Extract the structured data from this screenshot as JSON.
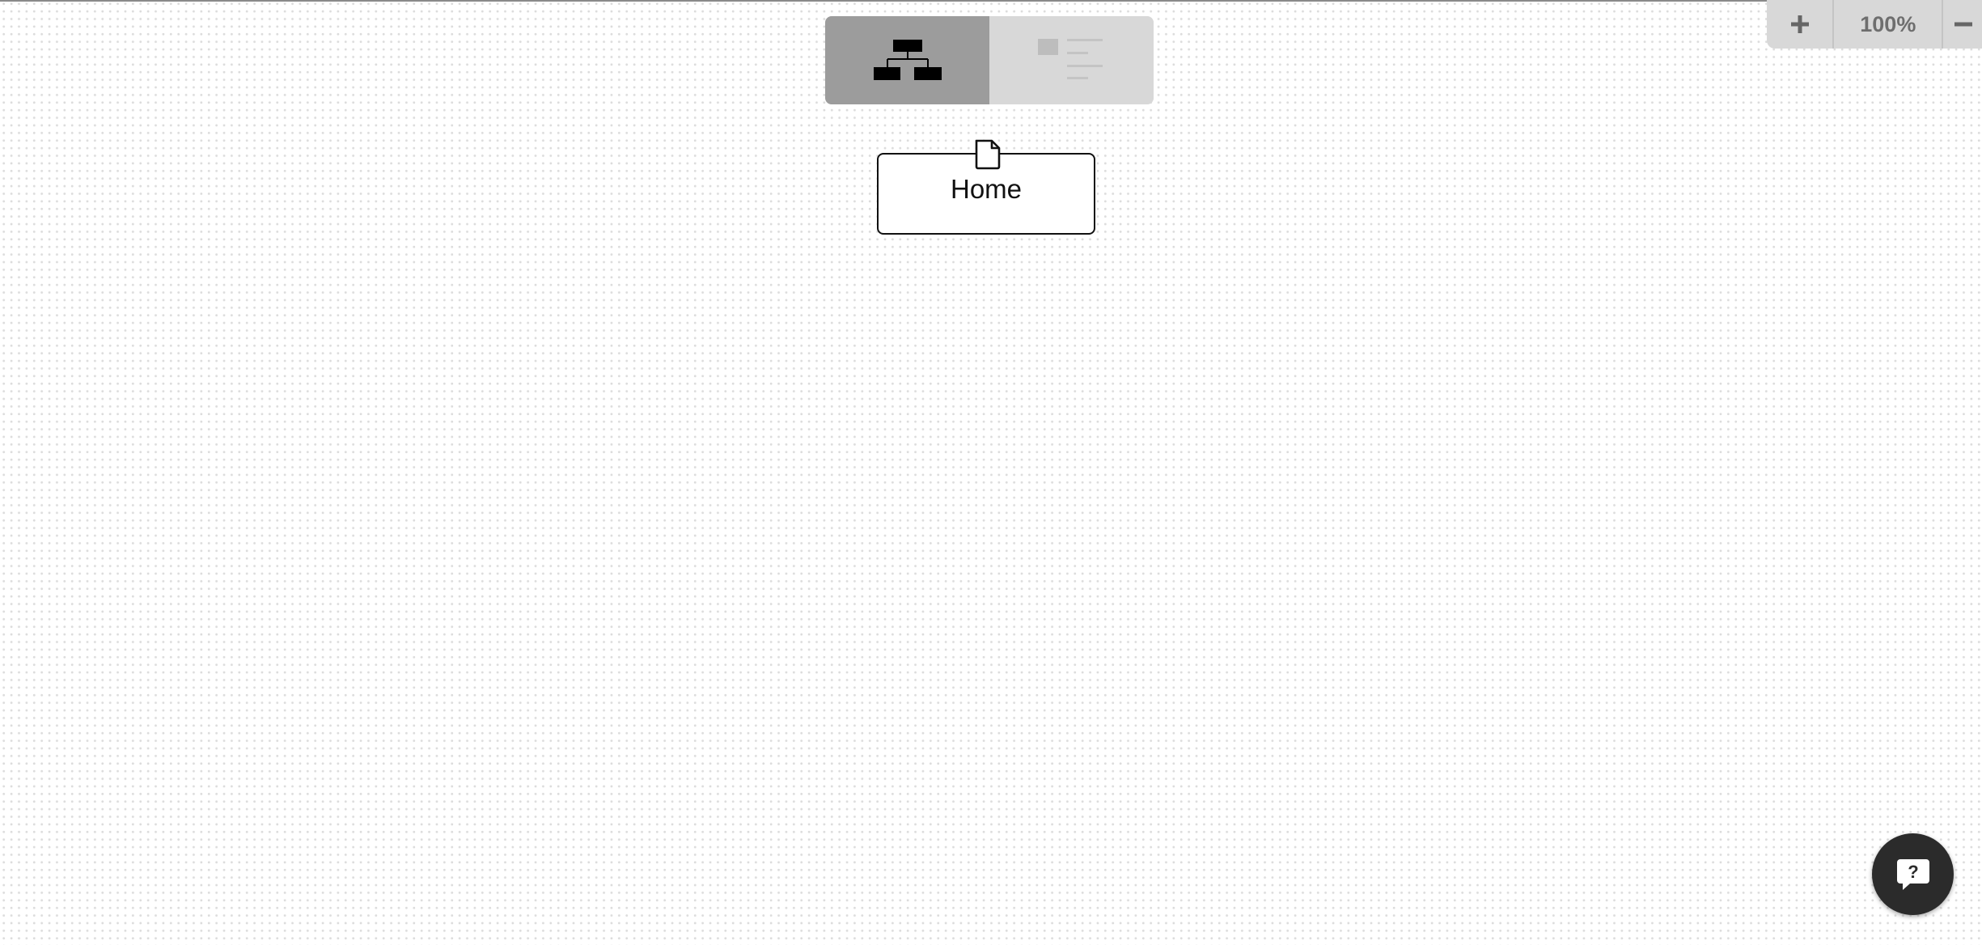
{
  "view_switcher": {
    "options": [
      {
        "name": "sitemap-tree-view",
        "icon": "sitemap-icon",
        "active": true
      },
      {
        "name": "list-outline-view",
        "icon": "outline-list-icon",
        "active": false
      }
    ]
  },
  "zoom": {
    "plus_label": "+",
    "level": "100%",
    "minus_label": "−"
  },
  "node": {
    "label": "Home",
    "icon": "page-icon"
  },
  "help": {
    "label": "?",
    "icon": "help-chat-icon"
  },
  "colors": {
    "active_toggle": "#9c9c9c",
    "inactive_toggle": "#d8d8d8",
    "help_button": "#2b2b2b",
    "node_border": "#111111"
  }
}
